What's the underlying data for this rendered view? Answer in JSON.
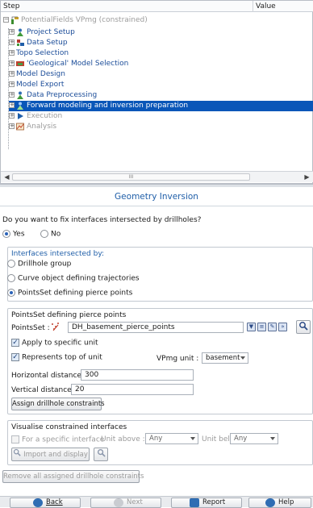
{
  "tree": {
    "columns": {
      "step": "Step",
      "value": "Value"
    },
    "root": {
      "label": "PotentialFields VPmg (constrained)",
      "icon_badge": "VPmg"
    },
    "items": [
      {
        "label": "Project Setup",
        "icon": "person-icon"
      },
      {
        "label": "Data Setup",
        "icon": "data-icon"
      },
      {
        "label": "Topo Selection",
        "icon": ""
      },
      {
        "label": "'Geological' Model Selection",
        "icon": "model-icon"
      },
      {
        "label": "Model Design",
        "icon": ""
      },
      {
        "label": "Model Export",
        "icon": ""
      },
      {
        "label": "Data Preprocessing",
        "icon": "person-icon"
      },
      {
        "label": "Forward modeling and inversion preparation",
        "icon": "person-icon",
        "selected": true
      },
      {
        "label": "Execution",
        "icon": "play-icon",
        "disabled": true
      },
      {
        "label": "Analysis",
        "icon": "analysis-icon",
        "disabled": true
      }
    ],
    "scroll_thumb": "III"
  },
  "panel": {
    "title": "Geometry Inversion",
    "question": "Do you want to fix interfaces intersected by drillholes?",
    "yes_label": "Yes",
    "no_label": "No",
    "yes_selected": true,
    "interfaces_group": {
      "title": "Interfaces intersected by:",
      "options": [
        "Drillhole group",
        "Curve object defining trajectories",
        "PointsSet defining pierce points"
      ],
      "selected_index": 2
    },
    "pointsset_group": {
      "title": "PointsSet defining pierce points",
      "pointsset_label": "PointsSet :",
      "pointsset_value": "DH_basement_pierce_points",
      "apply_label": "Apply to specific unit",
      "apply_checked": true,
      "top_label": "Represents top of unit",
      "top_checked": true,
      "unit_label": "VPmg unit :",
      "unit_value": "basement",
      "hdist_label": "Horizontal distance :",
      "hdist_value": "300",
      "vdist_label": "Vertical distance :",
      "vdist_value": "20",
      "assign_button": "Assign drillhole constraints"
    },
    "visualise_group": {
      "title": "Visualise constrained interfaces",
      "specific_label": "For a specific interface",
      "specific_checked": false,
      "unit_above_label": "Unit above :",
      "unit_above_value": "Any",
      "unit_below_label": "Unit below :",
      "unit_below_value": "Any",
      "import_button": "Import and display"
    },
    "remove_button": "Remove all assigned drillhole constraints"
  },
  "nav": {
    "back": "Back",
    "next": "Next",
    "report": "Report",
    "help": "Help"
  },
  "colors": {
    "accent": "#1f5ea8",
    "selection": "#0a56b8",
    "tree_link": "#1c4d99"
  }
}
